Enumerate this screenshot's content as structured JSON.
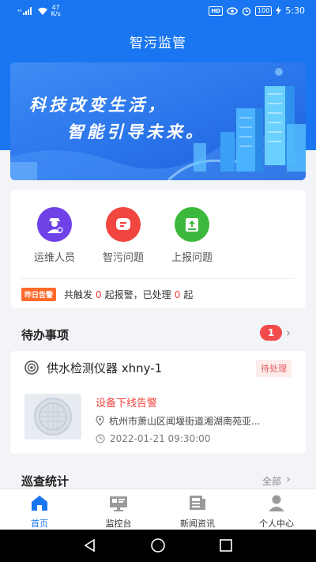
{
  "status_bar": {
    "signal": "⁴⁶",
    "speed_value": "47",
    "speed_unit": "K/s",
    "hd": "HD",
    "battery": "100",
    "time": "5:30"
  },
  "header": {
    "title": "智污监管"
  },
  "banner": {
    "line1": "科技改变生活，",
    "line2": "智能引导未来。"
  },
  "quick_actions": [
    {
      "label": "运维人员",
      "icon": "maintenance-worker-icon",
      "color": "#6f42e8"
    },
    {
      "label": "智污问题",
      "icon": "message-icon",
      "color": "#f0463f"
    },
    {
      "label": "上报问题",
      "icon": "upload-icon",
      "color": "#3cb93c"
    }
  ],
  "alarm_summary": {
    "badge": "昨日告警",
    "prefix": "共触发",
    "triggered": "0",
    "middle": "起报警，已处理",
    "handled": "0",
    "suffix": "起"
  },
  "todo": {
    "title": "待办事项",
    "count": "1",
    "item": {
      "name": "供水检测仪器 xhny-1",
      "status": "待处理",
      "alarm": "设备下线告警",
      "address": "杭州市萧山区闻堰街道湘湖南苑亚...",
      "time": "2022-01-21 09:30:00"
    }
  },
  "inspection": {
    "title": "巡查统计",
    "more": "全部"
  },
  "tabs": [
    {
      "label": "首页",
      "icon": "home-icon",
      "active": true
    },
    {
      "label": "监控台",
      "icon": "monitor-icon",
      "active": false
    },
    {
      "label": "新闻资讯",
      "icon": "news-icon",
      "active": false
    },
    {
      "label": "个人中心",
      "icon": "user-icon",
      "active": false
    }
  ],
  "colors": {
    "primary": "#1976f0",
    "alert": "#f0463f",
    "badge": "#ff6a2b"
  }
}
